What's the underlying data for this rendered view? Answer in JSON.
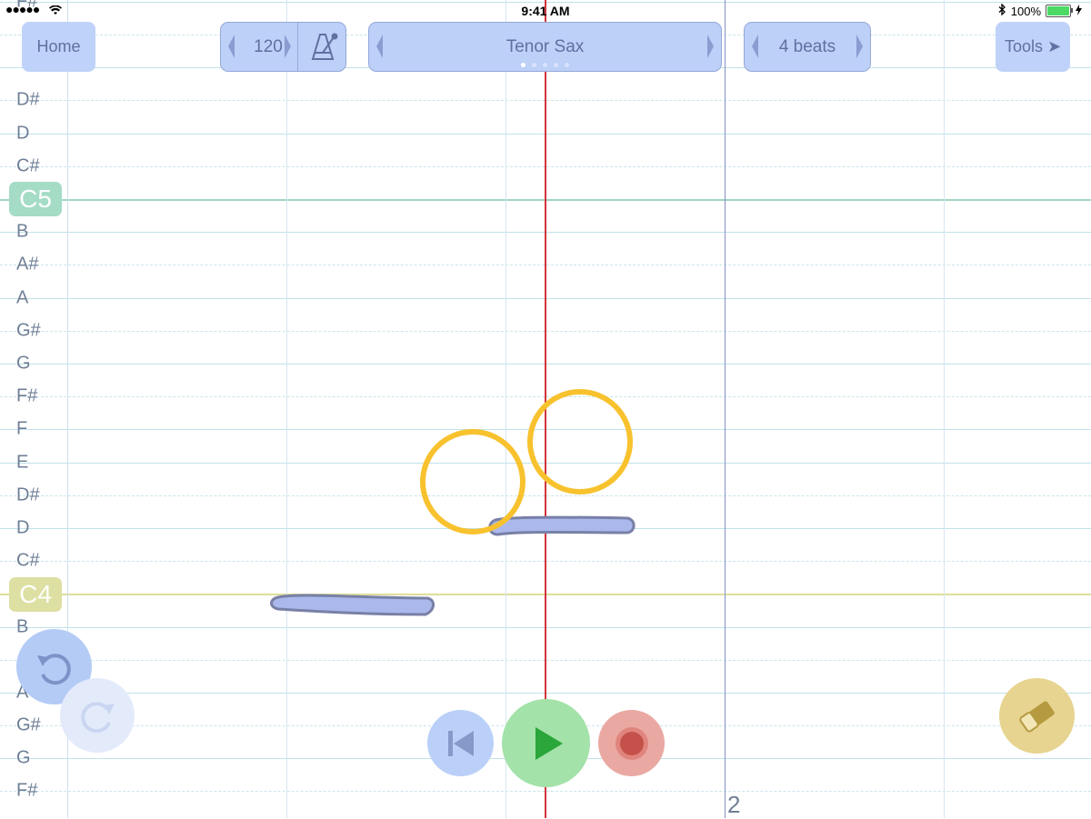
{
  "status_bar": {
    "signal": "●●●●●",
    "time": "9:41 AM",
    "battery_text": "100%",
    "icons": [
      "wifi-icon",
      "bluetooth-icon",
      "battery-icon",
      "charging-icon"
    ]
  },
  "toolbar": {
    "home_label": "Home",
    "tempo_value": "120",
    "metronome_icon": "metronome-icon",
    "instrument_label": "Tenor Sax",
    "beats_label": "4 beats",
    "tools_label": "Tools ➤"
  },
  "note_labels": [
    "F#",
    "D#",
    "D",
    "C#",
    "B",
    "A#",
    "A",
    "G#",
    "G",
    "F#",
    "F",
    "E",
    "D#",
    "D",
    "C#",
    "B",
    "A",
    "G#",
    "G",
    "F#"
  ],
  "highlight_notes": {
    "c5": "C5",
    "c4": "C4"
  },
  "bar_number": "2",
  "controls": {
    "undo_icon": "undo-icon",
    "redo_icon": "redo-icon",
    "rewind_icon": "rewind-icon",
    "play_icon": "play-icon",
    "record_icon": "record-icon",
    "eraser_icon": "eraser-icon"
  },
  "colors": {
    "accent_blue": "#bdd0f8",
    "play_green": "#a3e2a9",
    "record_red": "#eaa8a2",
    "eraser_yellow": "#e7d490",
    "playhead_red": "#d0343a",
    "touch_ring": "#f8c22e"
  }
}
